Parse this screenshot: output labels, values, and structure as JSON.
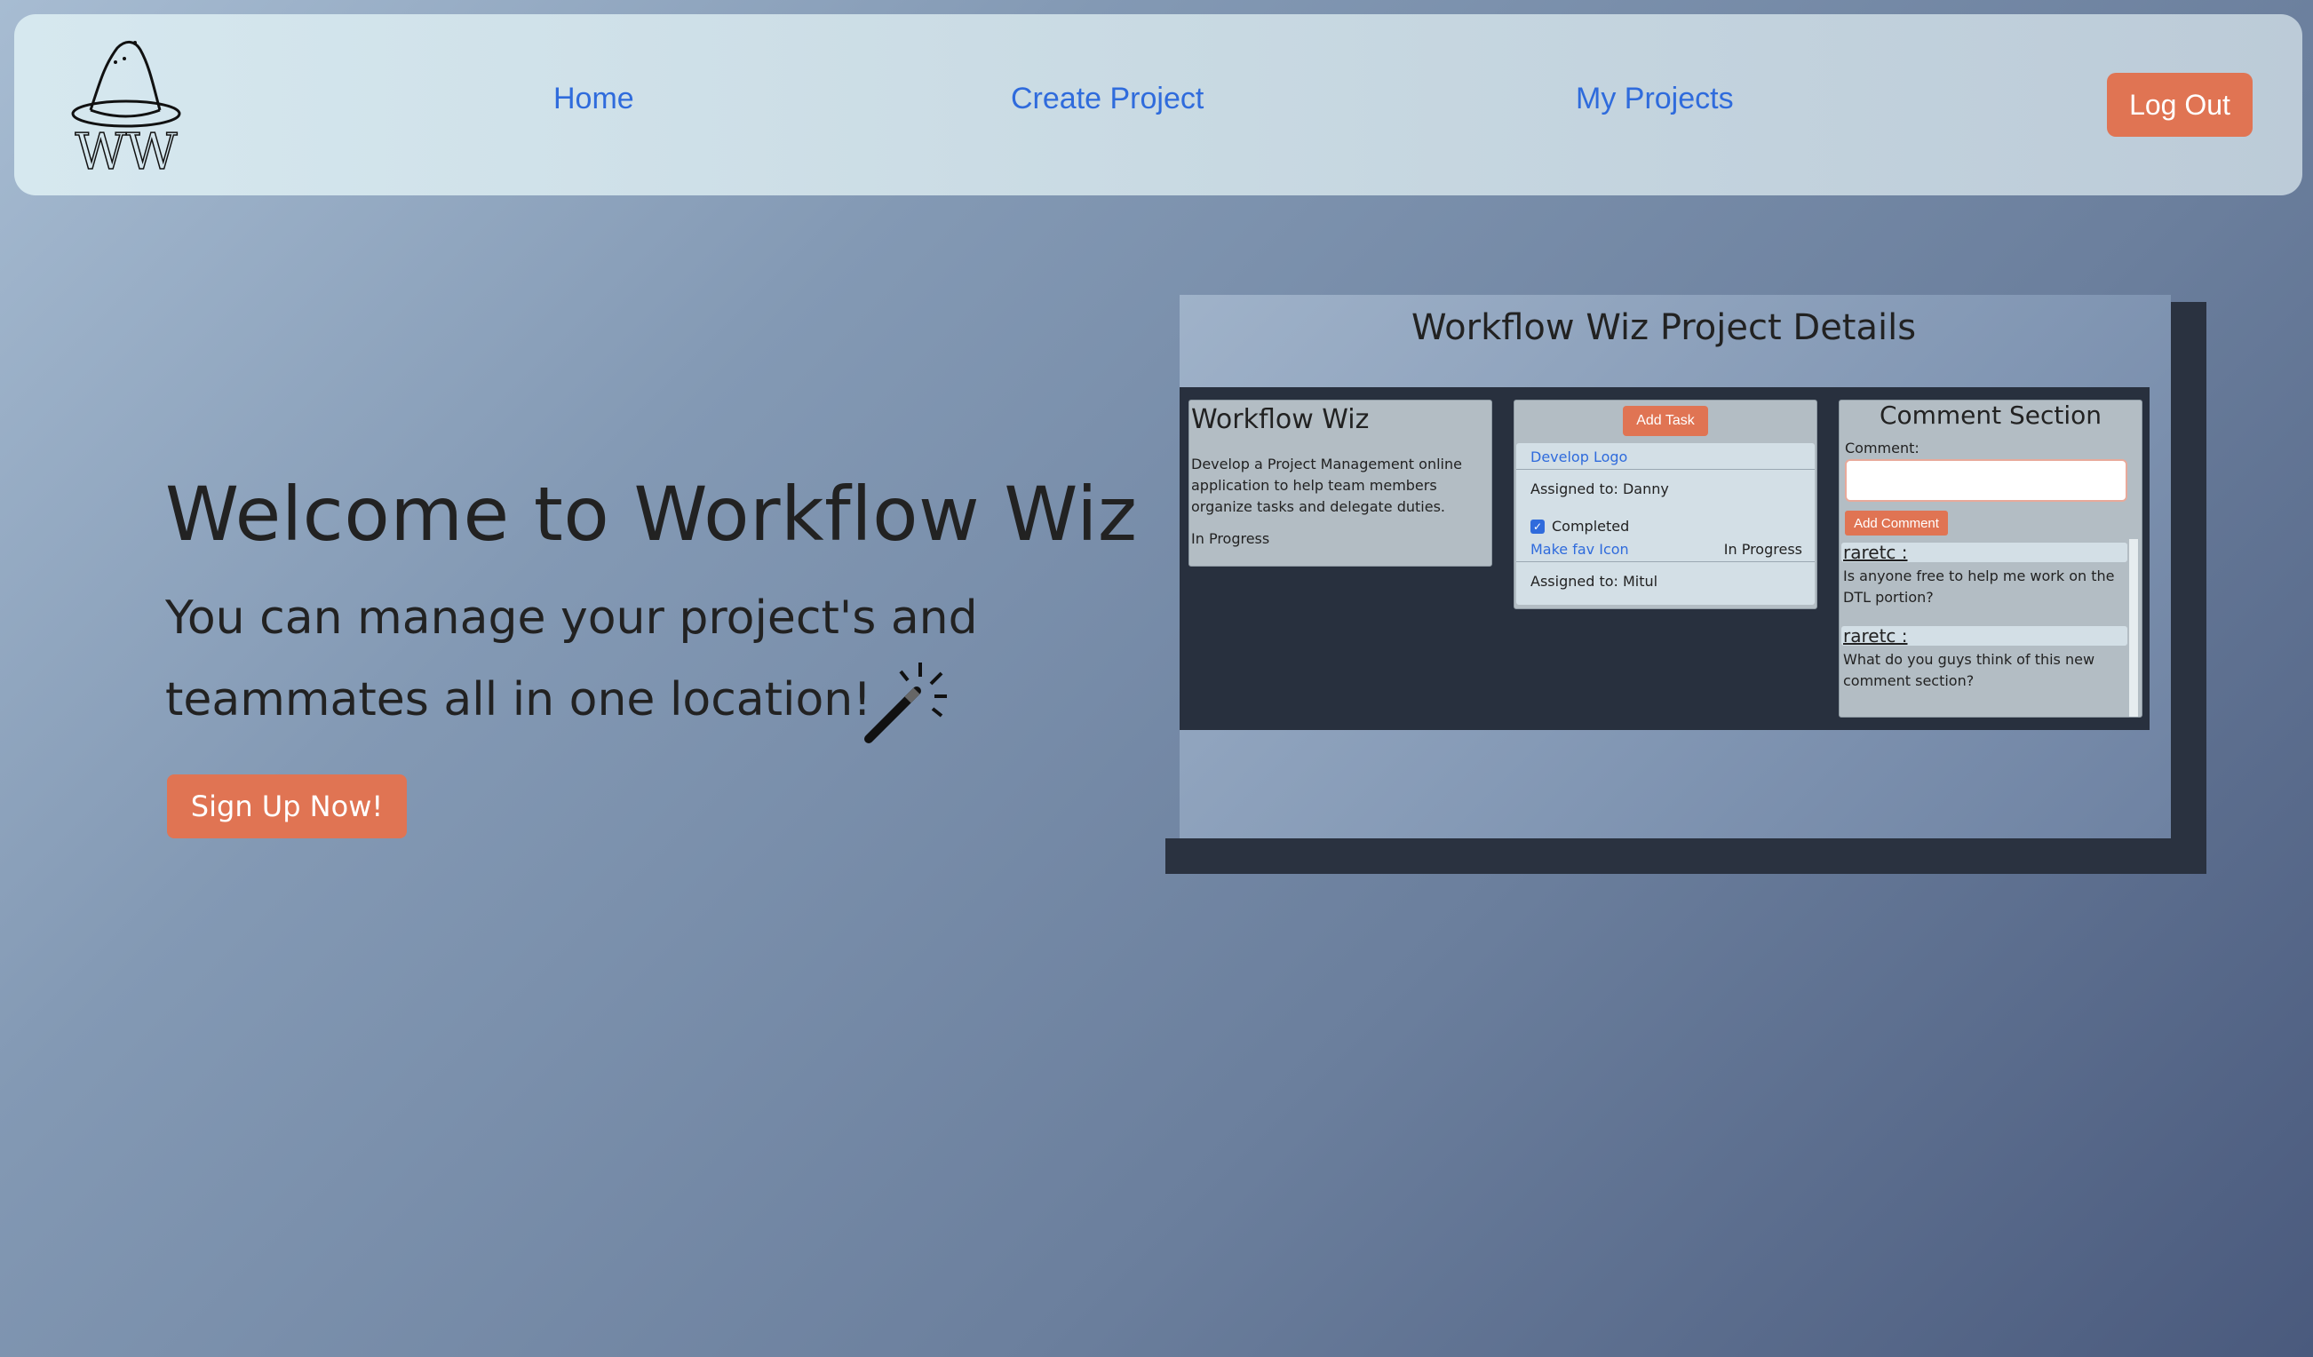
{
  "nav": {
    "logo_text": "WW",
    "links": [
      "Home",
      "Create Project",
      "My Projects"
    ],
    "logout_label": "Log Out"
  },
  "hero": {
    "title": "Welcome to Workflow Wiz",
    "subtitle": "You can manage your project's and teammates all in one location!",
    "signup_label": "Sign Up Now!",
    "icon": "magic-wand-icon"
  },
  "preview": {
    "title": "Workflow Wiz Project Details",
    "project": {
      "name": "Workflow Wiz",
      "description": "Develop a Project Management online application to help team members organize tasks and delegate duties.",
      "status": "In Progress"
    },
    "add_task_label": "Add Task",
    "tasks": [
      {
        "name": "Develop Logo",
        "status": "",
        "assigned": "Assigned to: Danny",
        "completed_label": "Completed",
        "completed": true
      },
      {
        "name": "Make fav Icon",
        "status": "In Progress",
        "assigned": "Assigned to: Mitul"
      }
    ],
    "comment_section": {
      "title": "Comment Section",
      "label": "Comment:",
      "button": "Add Comment",
      "comments": [
        {
          "user": "raretc :",
          "text": "Is anyone free to help me work on the DTL portion?"
        },
        {
          "user": "raretc :",
          "text": "What do you guys think of this new comment section?"
        }
      ]
    }
  },
  "colors": {
    "accent": "#e07453",
    "link": "#2f6bdc",
    "dark_panel": "#28303e"
  }
}
